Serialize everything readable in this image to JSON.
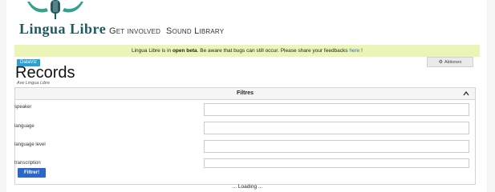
{
  "header": {
    "brand": "Lingua Libre",
    "nav": [
      "Get involved",
      "Sound Library"
    ]
  },
  "banner": {
    "prefix": "Lingua Libre is in ",
    "bold": "open beta",
    "middle": ". Be aware that bugs can still occur. Please share your feedbacks ",
    "link": "here",
    "suffix": " !"
  },
  "page": {
    "badge": "DataViz",
    "title": "Records",
    "subtitle": "Ave Lingua Libre",
    "action": "Aktionen"
  },
  "filters": {
    "heading": "Filtres",
    "fields": [
      {
        "label": "speaker",
        "value": ""
      },
      {
        "label": "language",
        "value": ""
      },
      {
        "label": "language level",
        "value": ""
      },
      {
        "label": "transcription",
        "value": ""
      }
    ],
    "submit": "Filtrer!"
  },
  "status": "... Loading ...",
  "colors": {
    "brand_dark": "#1f5a5e",
    "brand_accent": "#30a38f",
    "banner_bg": "#ecf4b8",
    "badge": "#2a9fd6",
    "submit": "#2b66c8"
  }
}
